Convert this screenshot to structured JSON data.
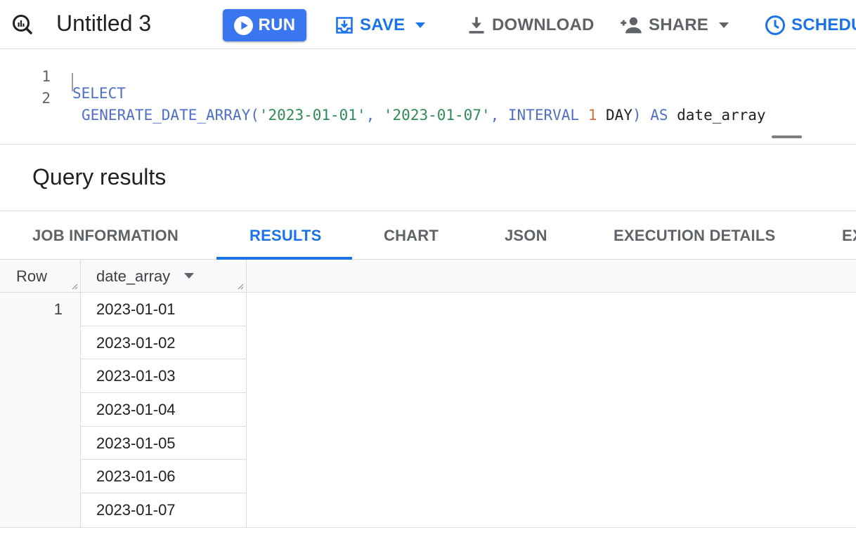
{
  "toolbar": {
    "title": "Untitled 3",
    "run_label": "RUN",
    "save_label": "SAVE",
    "download_label": "DOWNLOAD",
    "share_label": "SHARE",
    "schedule_label": "SCHEDU",
    "colors": {
      "accent": "#1a73e8",
      "run_bg": "#3a76f0"
    }
  },
  "editor": {
    "lines": [
      {
        "number": "1",
        "tokens": [
          {
            "t": "kw",
            "v": "SELECT"
          }
        ]
      },
      {
        "number": "2",
        "tokens": [
          {
            "t": "kw",
            "v": "GENERATE_DATE_ARRAY("
          },
          {
            "t": "str",
            "v": "'2023-01-01'"
          },
          {
            "t": "kw",
            "v": ", "
          },
          {
            "t": "str",
            "v": "'2023-01-07'"
          },
          {
            "t": "kw",
            "v": ", INTERVAL "
          },
          {
            "t": "num",
            "v": "1"
          },
          {
            "t": "plain",
            "v": " DAY"
          },
          {
            "t": "kw",
            "v": ") AS "
          },
          {
            "t": "plain",
            "v": "date_array"
          }
        ]
      }
    ]
  },
  "results": {
    "title": "Query results",
    "tabs": [
      {
        "label": "JOB INFORMATION",
        "active": false
      },
      {
        "label": "RESULTS",
        "active": true
      },
      {
        "label": "CHART",
        "active": false
      },
      {
        "label": "JSON",
        "active": false
      },
      {
        "label": "EXECUTION DETAILS",
        "active": false
      },
      {
        "label": "EX",
        "active": false
      }
    ],
    "columns": [
      "Row",
      "date_array"
    ],
    "row_number": "1",
    "values": [
      "2023-01-01",
      "2023-01-02",
      "2023-01-03",
      "2023-01-04",
      "2023-01-05",
      "2023-01-06",
      "2023-01-07"
    ]
  }
}
